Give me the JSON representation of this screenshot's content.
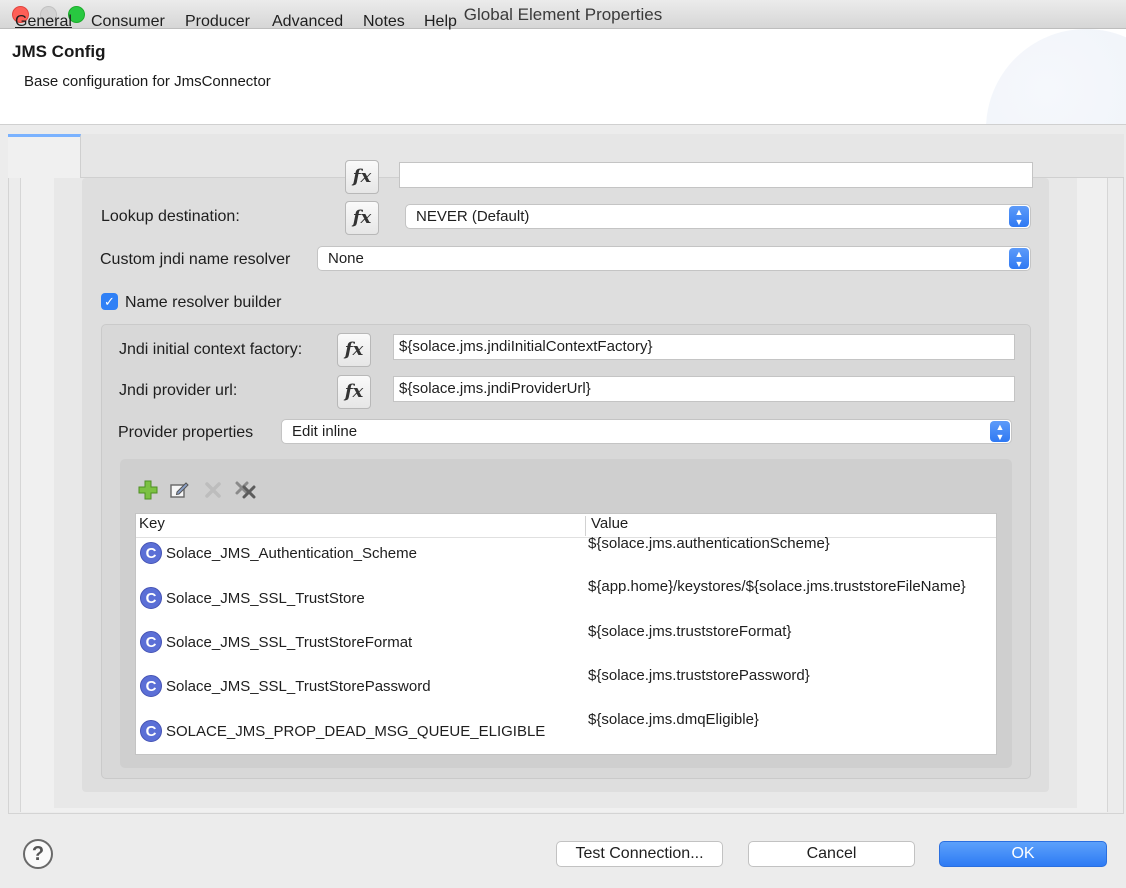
{
  "window": {
    "title": "Global Element Properties"
  },
  "header": {
    "title": "JMS Config",
    "description": "Base configuration for JmsConnector"
  },
  "tabs": [
    {
      "label": "General",
      "active": true
    },
    {
      "label": "Consumer"
    },
    {
      "label": "Producer"
    },
    {
      "label": "Advanced"
    },
    {
      "label": "Notes"
    },
    {
      "label": "Help"
    }
  ],
  "form": {
    "lookup_destination": {
      "label": "Lookup destination:",
      "value": "NEVER (Default)"
    },
    "custom_jndi": {
      "label": "Custom jndi name resolver",
      "value": "None"
    },
    "name_resolver_builder": {
      "label": "Name resolver builder",
      "checked": true
    },
    "jndi_factory": {
      "label": "Jndi initial context factory:",
      "value": "${solace.jms.jndiInitialContextFactory}"
    },
    "jndi_url": {
      "label": "Jndi provider url:",
      "value": "${solace.jms.jndiProviderUrl}"
    },
    "provider_properties": {
      "label": "Provider properties",
      "value": "Edit inline"
    },
    "fx_label": "fx"
  },
  "table": {
    "headers": {
      "key": "Key",
      "value": "Value"
    },
    "rows": [
      {
        "key": "Solace_JMS_Authentication_Scheme",
        "value": "${solace.jms.authenticationScheme}"
      },
      {
        "key": "Solace_JMS_SSL_TrustStore",
        "value": "${app.home}/keystores/${solace.jms.truststoreFileName}"
      },
      {
        "key": "Solace_JMS_SSL_TrustStoreFormat",
        "value": "${solace.jms.truststoreFormat}"
      },
      {
        "key": "Solace_JMS_SSL_TrustStorePassword",
        "value": "${solace.jms.truststorePassword}"
      },
      {
        "key": "SOLACE_JMS_PROP_DEAD_MSG_QUEUE_ELIGIBLE",
        "value": "${solace.jms.dmqEligible}"
      }
    ],
    "row_icon": "C"
  },
  "toolbar": {
    "icons": [
      "add-icon",
      "edit-icon",
      "delete-icon",
      "remove-all-icon"
    ]
  },
  "buttons": {
    "help": "?",
    "test_connection": "Test Connection...",
    "cancel": "Cancel",
    "ok": "OK"
  },
  "colors": {
    "accent": "#2f7bf4",
    "row_icon": "#5b6fd6"
  }
}
